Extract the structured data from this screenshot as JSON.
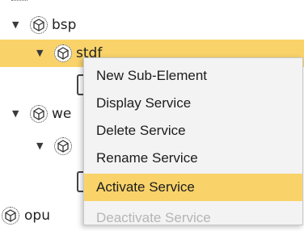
{
  "tree": {
    "nodes": [
      {
        "label": "bsp",
        "expanded": true,
        "icon": "service-node-icon"
      },
      {
        "label": "stdf",
        "expanded": true,
        "selected": true,
        "icon": "service-node-icon"
      },
      {
        "label": "we",
        "expanded": true,
        "icon": "service-node-icon"
      },
      {
        "label": "",
        "expanded": true,
        "icon": "service-node-icon"
      },
      {
        "label": "opu",
        "expanded": false,
        "icon": "service-node-icon"
      }
    ]
  },
  "context_menu": {
    "items": [
      {
        "label": "New Sub-Element",
        "state": "normal"
      },
      {
        "label": "Display Service",
        "state": "normal"
      },
      {
        "label": "Delete Service",
        "state": "normal"
      },
      {
        "label": "Rename Service",
        "state": "normal"
      },
      {
        "label": "Activate Service",
        "state": "highlighted"
      },
      {
        "label": "Deactivate Service",
        "state": "disabled"
      }
    ]
  },
  "colors": {
    "selection": "#f9d36a",
    "disabled_text": "#b5b5b5"
  }
}
